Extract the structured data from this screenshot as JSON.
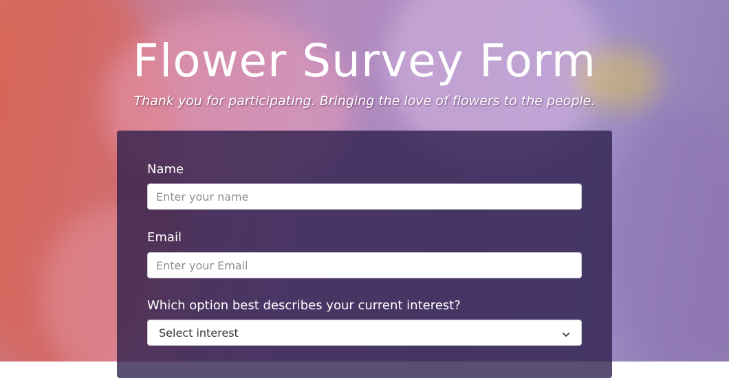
{
  "page": {
    "title": "Flower Survey Form",
    "subtitle": "Thank you for participating. Bringing the love of flowers to the people."
  },
  "form": {
    "name_label": "Name",
    "name_placeholder": "Enter your name",
    "email_label": "Email",
    "email_placeholder": "Enter your Email",
    "interest_label": "Which option best describes your current interest?",
    "interest_selected": "Select interest"
  },
  "colors": {
    "card_background": "#2b1e4a",
    "text": "#ffffff"
  },
  "icons": {
    "select_arrow": "chevron-down-icon"
  }
}
